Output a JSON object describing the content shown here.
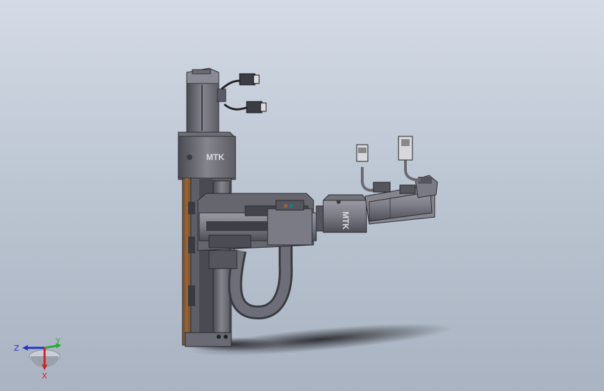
{
  "model": {
    "brand_label": "MTK",
    "parts": [
      "vertical-motor",
      "vertical-gearbox",
      "vertical-linear-module",
      "horizontal-linear-module",
      "horizontal-gearbox",
      "horizontal-motor",
      "cable-chain",
      "motor-connectors"
    ]
  },
  "triad": {
    "x_label": "X",
    "y_label": "Y",
    "z_label": "Z",
    "colors": {
      "x": "#d42020",
      "y": "#2eaa3a",
      "z": "#2234c8"
    }
  },
  "colors": {
    "background_top": "#d4dbe6",
    "background_bottom": "#a9b3c1",
    "metal_dark": "#55555f",
    "metal_mid": "#77777f",
    "metal_light": "#9a9aa4",
    "accent_copper": "#a0602a"
  }
}
